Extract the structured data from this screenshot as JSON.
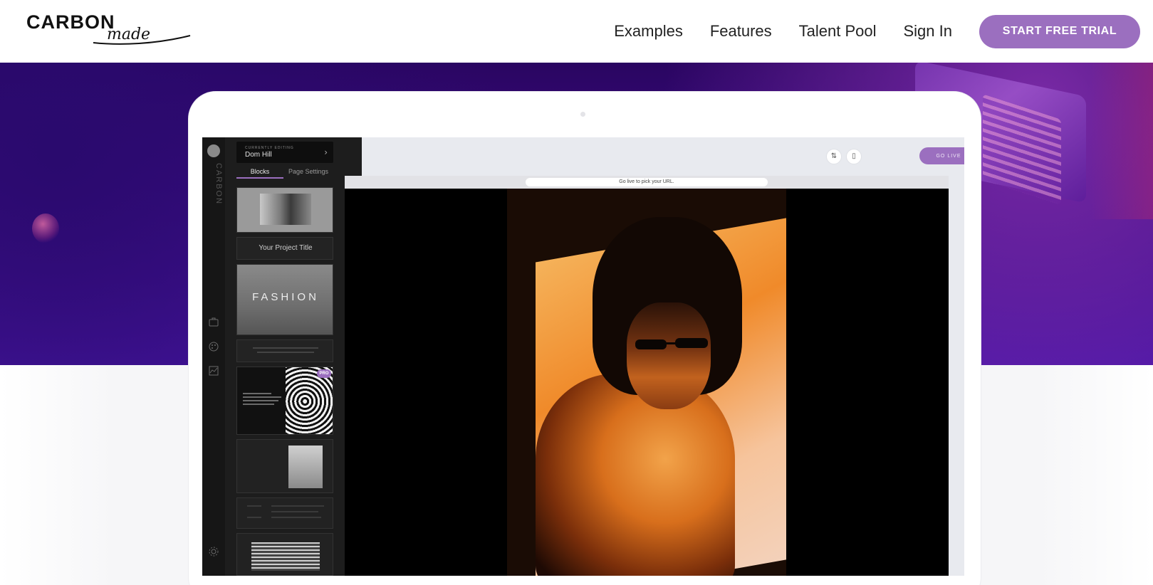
{
  "header": {
    "logo_main": "CARBON",
    "logo_sub": "made",
    "nav": [
      "Examples",
      "Features",
      "Talent Pool",
      "Sign In"
    ],
    "cta": "START FREE TRIAL"
  },
  "colors": {
    "accent": "#9b6fbf",
    "hero_top": "#2a0561",
    "hero_bottom": "#4a16a8"
  },
  "editor": {
    "rail_logo_text": "CARBON",
    "listing_caption": "CURRENTLY EDITING",
    "listing_name": "Dom Hill",
    "tabs": [
      "Blocks",
      "Page Settings"
    ],
    "active_tab": "Blocks",
    "project_title_block": "Your Project Title",
    "fashion_block": "FASHION",
    "pro_badge": "PRO",
    "go_live": "GO LIVE",
    "url_hint": "Go live to pick your URL."
  }
}
